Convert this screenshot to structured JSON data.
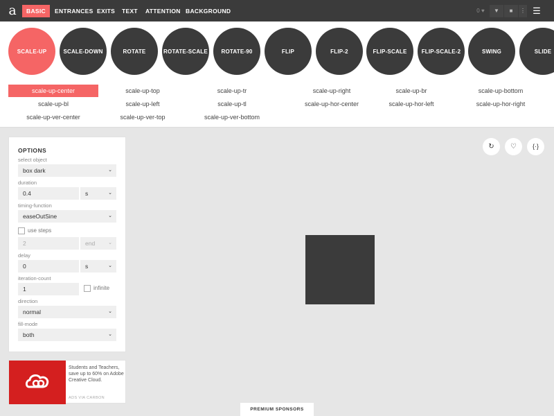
{
  "nav": {
    "logo": "a",
    "tabs": [
      "BASIC",
      "ENTRANCES",
      "EXITS",
      "TEXT",
      "ATTENTION",
      "BACKGROUND"
    ],
    "fav_count": "0",
    "menu_icon": "hamburger-icon"
  },
  "animations": [
    "SCALE-UP",
    "SCALE-DOWN",
    "ROTATE",
    "ROTATE-SCALE",
    "ROTATE-90",
    "FLIP",
    "FLIP-2",
    "FLIP-SCALE",
    "FLIP-SCALE-2",
    "SWING",
    "SLIDE"
  ],
  "variants": [
    "scale-up-center",
    "scale-up-top",
    "scale-up-tr",
    "scale-up-right",
    "scale-up-br",
    "scale-up-bottom",
    "scale-up-bl",
    "scale-up-left",
    "scale-up-tl",
    "scale-up-hor-center",
    "scale-up-hor-left",
    "scale-up-hor-right",
    "scale-up-ver-center",
    "scale-up-ver-top",
    "scale-up-ver-bottom"
  ],
  "options": {
    "title": "OPTIONS",
    "select_object_label": "select object",
    "select_object_value": "box dark",
    "duration_label": "duration",
    "duration_value": "0.4",
    "duration_unit": "s",
    "timing_label": "timing-function",
    "timing_value": "easeOutSine",
    "use_steps_label": "use steps",
    "steps_value": "2",
    "steps_position": "end",
    "delay_label": "delay",
    "delay_value": "0",
    "delay_unit": "s",
    "iteration_label": "iteration-count",
    "iteration_value": "1",
    "infinite_label": "infinite",
    "direction_label": "direction",
    "direction_value": "normal",
    "fill_label": "fill-mode",
    "fill_value": "both"
  },
  "ad": {
    "text": "Students and Teachers, save up to 60% on Adobe Creative Cloud.",
    "via": "ADS VIA CARBON"
  },
  "sponsors_label": "PREMIUM SPONSORS",
  "colors": {
    "accent": "#f56565",
    "dark": "#3b3b3b"
  }
}
